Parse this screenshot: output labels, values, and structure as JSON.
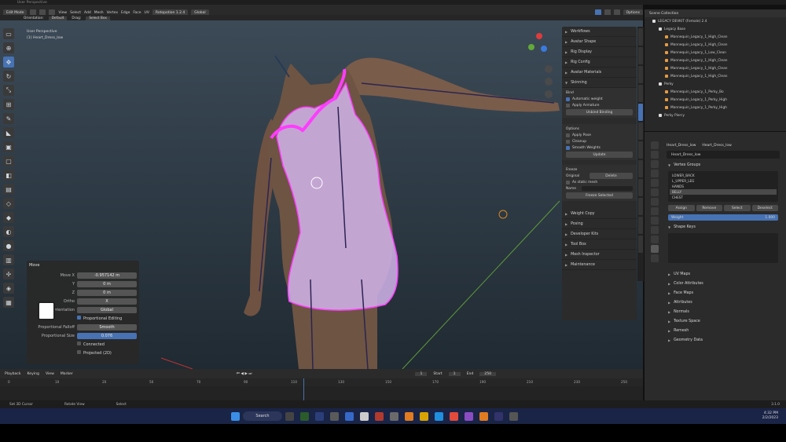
{
  "app": {
    "header_mode": "Edit Mode",
    "orientation_label": "Orientation:",
    "orientation_value": "Default",
    "drag_label": "Drag:",
    "drag_value": "Select Box",
    "menu": [
      "View",
      "Select",
      "Add",
      "Mesh",
      "Vertex",
      "Edge",
      "Face",
      "UV"
    ],
    "transform_dropdown": "Global",
    "pivot_dropdown": "Rotopotion 1.2.4",
    "options_label": "Options"
  },
  "viewport": {
    "title": "User Perspective",
    "object": "(1) Heart_Dress_low"
  },
  "move_panel": {
    "title": "Move",
    "rows": [
      {
        "label": "Move X",
        "value": "-0.957142 m"
      },
      {
        "label": "Y",
        "value": "0 m"
      },
      {
        "label": "Z",
        "value": "0 m"
      }
    ],
    "ortho_label": "Ortho",
    "ortho_value": "X",
    "orientation_label": "Orientation",
    "orientation_value": "Global",
    "proportional_editing": "Proportional Editing",
    "falloff_label": "Proportional Falloff",
    "falloff_value": "Smooth",
    "size_label": "Proportional Size",
    "size_value": "0.076",
    "connected": "Connected",
    "projected": "Projected (2D)"
  },
  "npanel": {
    "top_sections": [
      "Workflows",
      "Avatar Shape",
      "Rig Display",
      "Rig Config",
      "Avatar Materials",
      "Skinning"
    ],
    "bind_title": "Bind",
    "automatic_weights": "Automatic weight",
    "apply_armature": "Apply Armature",
    "unbind_btn": "Unbind Binding",
    "options_title": "Options",
    "apply_pose": "Apply Pose",
    "cleanup": "Cleanup",
    "smooth_weights": "Smooth Weights",
    "update_btn": "Update",
    "freeze_title": "Freeze",
    "original_label": "Original",
    "original_value": "Delete",
    "as_static": "As static mesh",
    "name_label": "Name",
    "freeze_btn": "Freeze Selected",
    "bottom_sections": [
      "Weight Copy",
      "Posing",
      "Developer Kits",
      "Tool Box",
      "Mesh Inspector",
      "Maintenance"
    ]
  },
  "outliner": {
    "title": "Scene Collection",
    "root": "LEGACY DEVKIT (Female) 2.4",
    "rows": [
      "Legacy Base",
      "Mannequin_Legacy_1_High_Clean",
      "Mannequin_Legacy_1_High_Clean",
      "Mannequin_Legacy_1_Low_Clean",
      "Mannequin_Legacy_1_High_Clean",
      "Mannequin_Legacy_1_High_Clean",
      "Mannequin_Legacy_1_High_Clean",
      "Perky",
      "Mannequin_Legacy_1_Perky_Bo",
      "Mannequin_Legacy_1_Perky_High",
      "Mannequin_Legacy_1_Perky_High",
      "Perky Piercy"
    ]
  },
  "properties": {
    "object_name": "Heart_Dress_low",
    "mesh_name": "Heart_Dress_low",
    "data_name": "Heart_Dress_low",
    "vertex_groups_title": "Vertex Groups",
    "vertex_groups": [
      "LOWER_BACK",
      "L_UPPER_LEG",
      "HANDS",
      "BELLY",
      "CHEST"
    ],
    "vg_buttons": [
      "Assign",
      "Remove",
      "Select",
      "Deselect"
    ],
    "weight_label": "Weight",
    "weight_value": "1.000",
    "shape_keys": "Shape Keys",
    "sections": [
      "UV Maps",
      "Color Attributes",
      "Face Maps",
      "Attributes",
      "Normals",
      "Texture Space",
      "Remesh",
      "Geometry Data"
    ]
  },
  "timeline": {
    "playback": "Playback",
    "keying": "Keying",
    "view": "View",
    "marker": "Marker",
    "current": "1",
    "start_label": "Start",
    "start": "1",
    "end_label": "End",
    "end": "250",
    "ticks": [
      "0",
      "10",
      "20",
      "50",
      "70",
      "90",
      "110",
      "130",
      "150",
      "170",
      "190",
      "210",
      "230",
      "250"
    ]
  },
  "status": {
    "set_cursor": "Set 3D Cursor",
    "rotate_view": "Rotate View",
    "select": "Select",
    "version": "3.1.0"
  },
  "taskbar": {
    "search": "Search",
    "time": "4:32 PM",
    "date": "2/2/2023"
  },
  "colors": {
    "accent": "#4772b3",
    "mesh": "#ff3cff",
    "skin": "#7a5c4a"
  }
}
